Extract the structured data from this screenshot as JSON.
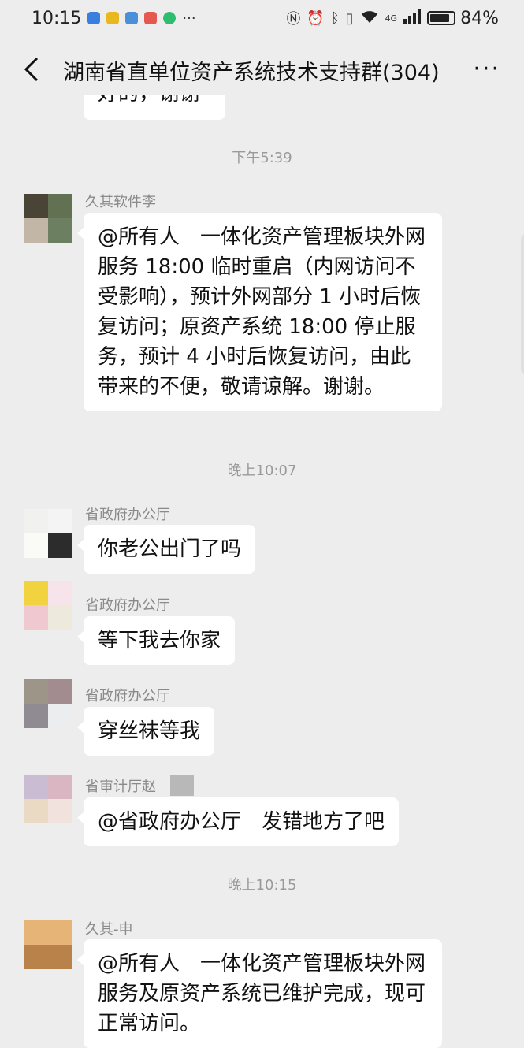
{
  "status_bar": {
    "time": "10:15",
    "battery": "84%",
    "battery_level": 0.84,
    "app_icons": [
      "#3a7ee0",
      "#e9b820",
      "#4a90d9",
      "#e5584f",
      "#2dbd6e"
    ],
    "extra_glyph": "···",
    "signal": "4G"
  },
  "nav": {
    "title": "湖南省直单位资产系统技术支持群(304)",
    "more": "···"
  },
  "chat": {
    "partial_message": "好的，谢谢",
    "messages": [
      {
        "type": "time",
        "text": "下午5:39"
      },
      {
        "type": "msg",
        "sender": "久其软件李",
        "text": "@所有人　一体化资产管理板块外网服务 18:00 临时重启（内网访问不受影响），预计外网部分 1 小时后恢复访问；原资产系统 18:00 停止服务，预计 4 小时后恢复访问，由此带来的不便，敬请谅解。谢谢。",
        "avatar_colors": [
          "#4a4436",
          "#617152",
          "#c2b6a6",
          "#6c8061"
        ]
      },
      {
        "type": "time",
        "text": "晚上10:07"
      },
      {
        "type": "msg",
        "sender": "省政府办公厅",
        "text": "你老公出门了吗",
        "avatar_colors": [
          "#f1f1ef",
          "#f4f4f4",
          "#fafaf6",
          "#2c2c2c"
        ]
      },
      {
        "type": "msg",
        "sender": "省政府办公厅",
        "text": "等下我去你家",
        "avatar_colors": [
          "#f0d33f",
          "#f6e4ea",
          "#efc9cf",
          "#eee9dd"
        ]
      },
      {
        "type": "msg",
        "sender": "省政府办公厅",
        "text": "穿丝袜等我",
        "avatar_colors": [
          "#9d9587",
          "#a28c90",
          "#908a92",
          "#ebedee"
        ]
      },
      {
        "type": "msg",
        "sender": "省审计厅赵",
        "text": "@省政府办公厅　发错地方了吧",
        "avatar_colors": [
          "#c9bcd3",
          "#dab6c3",
          "#eadac4",
          "#f1e2de"
        ]
      },
      {
        "type": "time",
        "text": "晚上10:15"
      },
      {
        "type": "msg",
        "sender": "久其-申",
        "text": "@所有人　一体化资产管理板块外网服务及原资产系统已维护完成，现可正常访问。",
        "avatar_colors": [
          "#e6b477",
          "#e6b477",
          "#b9824a",
          "#b9824a"
        ]
      }
    ]
  }
}
